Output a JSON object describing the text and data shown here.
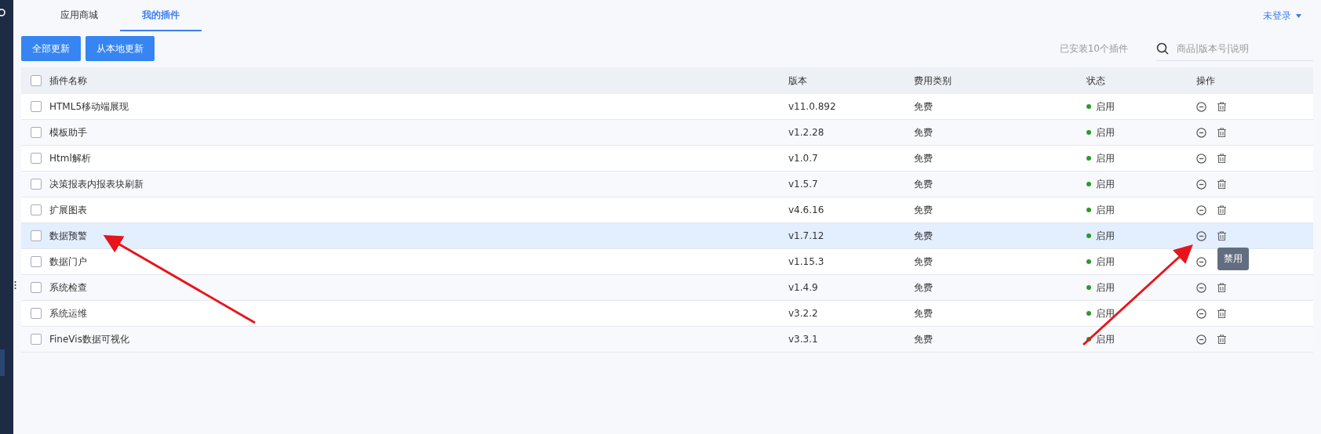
{
  "tabs": [
    {
      "label": "应用商城",
      "selected": false
    },
    {
      "label": "我的插件",
      "selected": true
    }
  ],
  "user_menu": {
    "label": "未登录"
  },
  "buttons": [
    "全部更新",
    "从本地更新"
  ],
  "installed_count": "已安装10个插件",
  "search": {
    "placeholder": "商品|版本号|说明"
  },
  "table": {
    "columns": [
      "插件名称",
      "版本",
      "费用类别",
      "状态",
      "操作"
    ],
    "header_checked": false,
    "rows": [
      {
        "name": "HTML5移动端展现",
        "version": "v11.0.892",
        "fee": "免费",
        "status": "启用",
        "checked": false,
        "hovered": false
      },
      {
        "name": "模板助手",
        "version": "v1.2.28",
        "fee": "免费",
        "status": "启用",
        "checked": false,
        "hovered": false
      },
      {
        "name": "Html解析",
        "version": "v1.0.7",
        "fee": "免费",
        "status": "启用",
        "checked": false,
        "hovered": false
      },
      {
        "name": "决策报表内报表块刷新",
        "version": "v1.5.7",
        "fee": "免费",
        "status": "启用",
        "checked": false,
        "hovered": false
      },
      {
        "name": "扩展图表",
        "version": "v4.6.16",
        "fee": "免费",
        "status": "启用",
        "checked": false,
        "hovered": false
      },
      {
        "name": "数据预警",
        "version": "v1.7.12",
        "fee": "免费",
        "status": "启用",
        "checked": false,
        "hovered": true
      },
      {
        "name": "数据门户",
        "version": "v1.15.3",
        "fee": "免费",
        "status": "启用",
        "checked": false,
        "hovered": false
      },
      {
        "name": "系统检查",
        "version": "v1.4.9",
        "fee": "免费",
        "status": "启用",
        "checked": false,
        "hovered": false
      },
      {
        "name": "系统运维",
        "version": "v3.2.2",
        "fee": "免费",
        "status": "启用",
        "checked": false,
        "hovered": false
      },
      {
        "name": "FineVis数据可视化",
        "version": "v3.3.1",
        "fee": "免费",
        "status": "启用",
        "checked": false,
        "hovered": false
      }
    ]
  },
  "tooltip": {
    "text": "禁用"
  }
}
